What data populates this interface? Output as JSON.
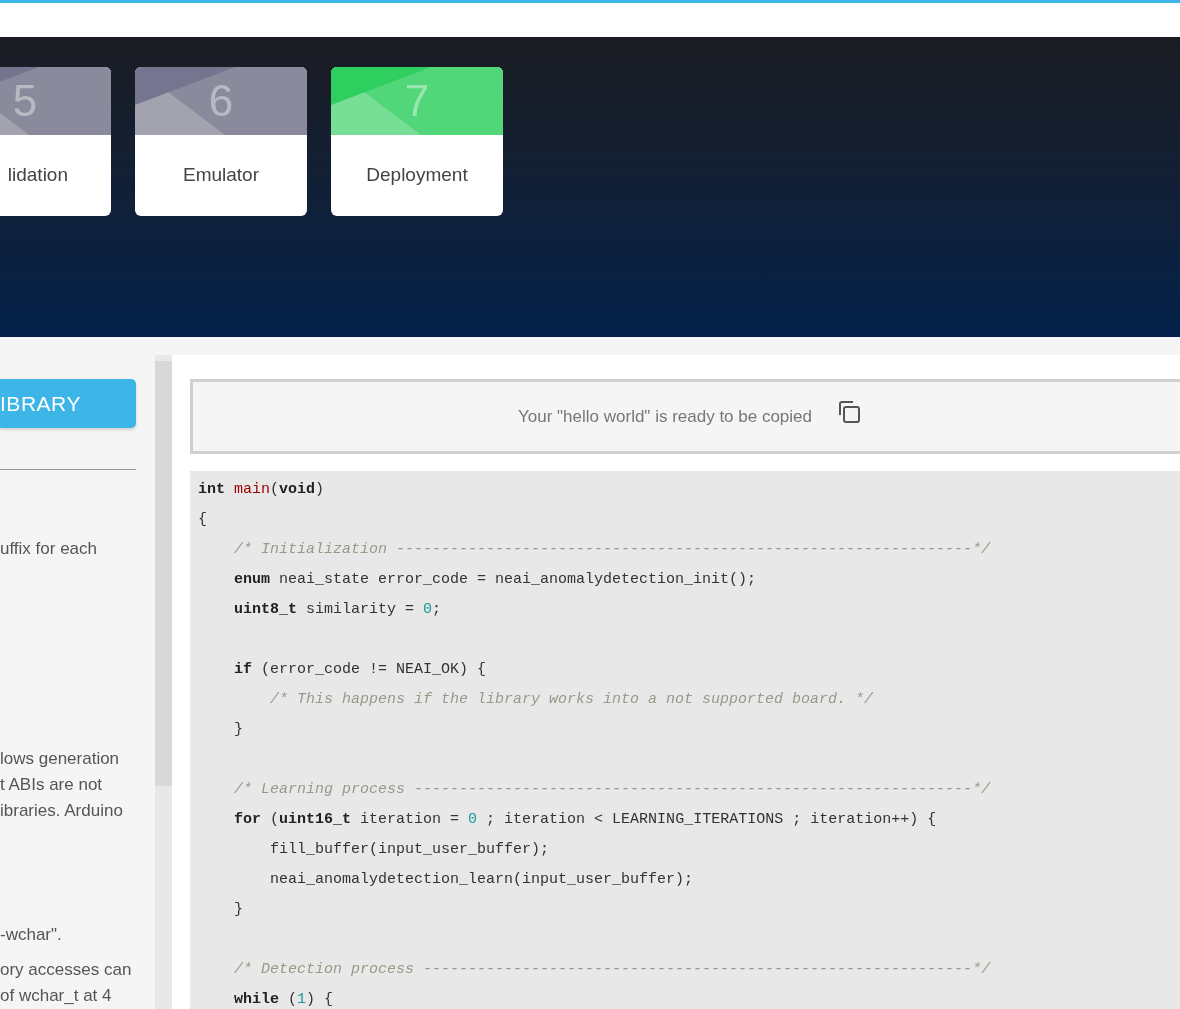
{
  "steps": [
    {
      "number": "5",
      "label": "lidation",
      "selected": false
    },
    {
      "number": "6",
      "label": "Emulator",
      "selected": false
    },
    {
      "number": "7",
      "label": "Deployment",
      "selected": true
    }
  ],
  "sidebar": {
    "button": "IBRARY",
    "paragraphs": [
      {
        "lines": [
          "uffix for each"
        ]
      },
      {
        "lines": [
          "lows generation",
          "t ABIs are not",
          "ibraries. Arduino"
        ]
      },
      {
        "lines": [
          "-wchar\"."
        ]
      },
      {
        "lines": [
          "ory accesses can",
          "of wchar_t at 4"
        ]
      }
    ]
  },
  "copy_banner": {
    "text": "Your \"hello world\" is ready to be copied"
  },
  "code": {
    "lines": [
      {
        "kind": "code",
        "tokens": [
          {
            "kind": "keyword",
            "text": "int "
          },
          {
            "kind": "function",
            "text": "main"
          },
          {
            "kind": "plain",
            "text": "("
          },
          {
            "kind": "keyword",
            "text": "void"
          },
          {
            "kind": "plain",
            "text": ")"
          }
        ]
      },
      {
        "kind": "code",
        "tokens": [
          {
            "kind": "plain",
            "text": "{"
          }
        ]
      },
      {
        "kind": "code",
        "tokens": [
          {
            "kind": "comment",
            "text": "    /* Initialization ----------------------------------------------------------------*/"
          }
        ]
      },
      {
        "kind": "code",
        "tokens": [
          {
            "kind": "keyword",
            "text": "    enum"
          },
          {
            "kind": "plain",
            "text": " neai_state error_code = neai_anomalydetection_init();"
          }
        ]
      },
      {
        "kind": "code",
        "tokens": [
          {
            "kind": "keyword",
            "text": "    uint8_t"
          },
          {
            "kind": "plain",
            "text": " similarity = "
          },
          {
            "kind": "number",
            "text": "0"
          },
          {
            "kind": "plain",
            "text": ";"
          }
        ]
      },
      {
        "kind": "blank"
      },
      {
        "kind": "code",
        "tokens": [
          {
            "kind": "keyword",
            "text": "    if"
          },
          {
            "kind": "plain",
            "text": " (error_code != NEAI_OK) {"
          }
        ]
      },
      {
        "kind": "code",
        "tokens": [
          {
            "kind": "comment",
            "text": "        /* This happens if the library works into a not supported board. */"
          }
        ]
      },
      {
        "kind": "code",
        "tokens": [
          {
            "kind": "plain",
            "text": "    }"
          }
        ]
      },
      {
        "kind": "blank"
      },
      {
        "kind": "code",
        "tokens": [
          {
            "kind": "comment",
            "text": "    /* Learning process --------------------------------------------------------------*/"
          }
        ]
      },
      {
        "kind": "code",
        "tokens": [
          {
            "kind": "keyword",
            "text": "    for"
          },
          {
            "kind": "plain",
            "text": " ("
          },
          {
            "kind": "keyword",
            "text": "uint16_t"
          },
          {
            "kind": "plain",
            "text": " iteration = "
          },
          {
            "kind": "number",
            "text": "0"
          },
          {
            "kind": "plain",
            "text": " ; iteration < LEARNING_ITERATIONS ; iteration++) {"
          }
        ]
      },
      {
        "kind": "code",
        "tokens": [
          {
            "kind": "plain",
            "text": "        fill_buffer(input_user_buffer);"
          }
        ]
      },
      {
        "kind": "code",
        "tokens": [
          {
            "kind": "plain",
            "text": "        neai_anomalydetection_learn(input_user_buffer);"
          }
        ]
      },
      {
        "kind": "code",
        "tokens": [
          {
            "kind": "plain",
            "text": "    }"
          }
        ]
      },
      {
        "kind": "blank"
      },
      {
        "kind": "code",
        "tokens": [
          {
            "kind": "comment",
            "text": "    /* Detection process -------------------------------------------------------------*/"
          }
        ]
      },
      {
        "kind": "code",
        "tokens": [
          {
            "kind": "keyword",
            "text": "    while"
          },
          {
            "kind": "plain",
            "text": " ("
          },
          {
            "kind": "number",
            "text": "1"
          },
          {
            "kind": "plain",
            "text": ") {"
          }
        ]
      }
    ]
  }
}
